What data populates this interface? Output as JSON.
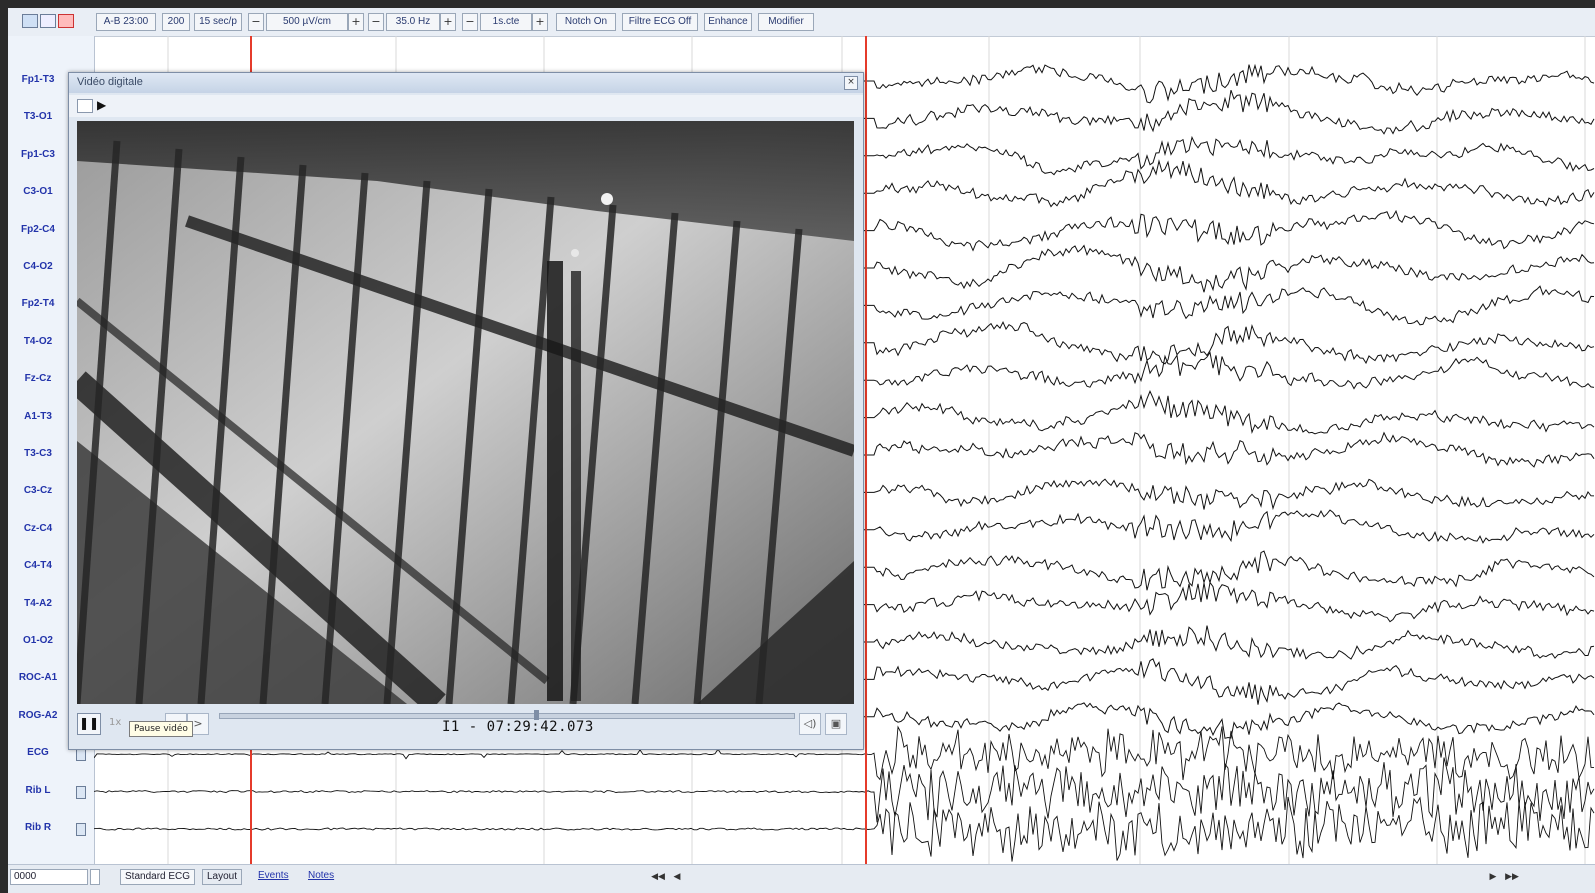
{
  "toolbar": {
    "montage": "A-B 23:00",
    "sample": "200",
    "timebase": "15 sec/p",
    "sensitivity": "500 µV/cm",
    "hi_filter": "35.0 Hz",
    "lo_filter": "1s.cte",
    "notch": "Notch On",
    "ecg_filter": "Filtre ECG Off",
    "enhance": "Enhance",
    "modifier": "Modifier",
    "minus": "−",
    "plus": "+"
  },
  "channels": [
    "Fp1-T3",
    "T3-O1",
    "Fp1-C3",
    "C3-O1",
    "Fp2-C4",
    "C4-O2",
    "Fp2-T4",
    "T4-O2",
    "Fz-Cz",
    "A1-T3",
    "T3-C3",
    "C3-Cz",
    "Cz-C4",
    "C4-T4",
    "T4-A2",
    "O1-O2",
    "ROC-A1",
    "ROG-A2",
    "ECG",
    "Rib L",
    "Rib R"
  ],
  "video": {
    "title": "Vidéo digitale",
    "close": "×",
    "play_glyph": "▶",
    "pause_glyph": "❚❚",
    "timecode": "I1 - 07:29:42.073",
    "tooltip": "Pause vidéo",
    "speed": "1x",
    "btn_left": "<",
    "btn_right": ">",
    "vol_glyph": "◁)",
    "snap_glyph": "▣",
    "seek_fraction": 0.55
  },
  "status": {
    "field": "0000",
    "tab_standard": "Standard ECG",
    "tab_layout": "Layout",
    "link_events": "Events",
    "link_notes": "Notes",
    "nav_back": "◀◀",
    "nav_prev": "◀",
    "nav_next": "▶",
    "nav_end": "▶▶"
  },
  "colors": {
    "marker": "#e53b2b",
    "label": "#2233aa",
    "trace": "#111111"
  }
}
